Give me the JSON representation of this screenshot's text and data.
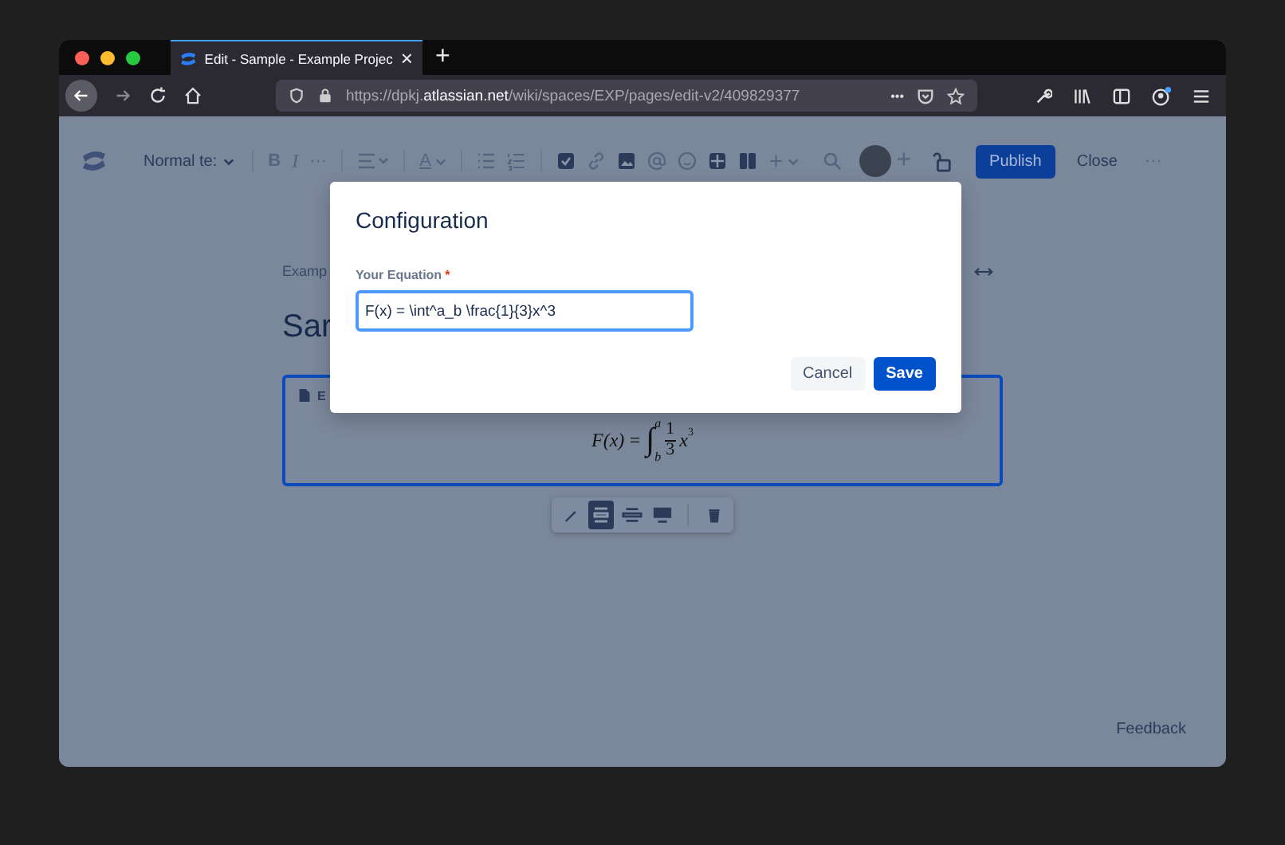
{
  "browser": {
    "tab": {
      "title": "Edit - Sample - Example Projec",
      "close": "×"
    },
    "new_tab": "+",
    "url": {
      "prefix": "https://dpkj.",
      "domain": "atlassian.net",
      "path": "/wiki/spaces/EXP/pages/edit-v2/409829377"
    },
    "page_actions": "•••"
  },
  "editor_toolbar": {
    "text_style": "Normal te:",
    "bold": "B",
    "italic": "I",
    "more": "···",
    "text_color": "A",
    "insert": "+",
    "collaborator_add": "+",
    "publish": "Publish",
    "close": "Close",
    "more_menu": "···"
  },
  "breadcrumb": "Examp",
  "page_title": "Sar",
  "macro": {
    "header": "E",
    "selected": true,
    "formula": {
      "lhs": "F(x) =",
      "integral": "∫",
      "upper": "a",
      "lower": "b",
      "numerator": "1",
      "denominator": "3",
      "base": "x",
      "exponent": "3"
    }
  },
  "macro_toolbar": [
    {
      "kind": "edit",
      "selected": false
    },
    {
      "kind": "layout-center",
      "selected": true
    },
    {
      "kind": "layout-wide",
      "selected": false
    },
    {
      "kind": "layout-full",
      "selected": false
    },
    {
      "kind": "delete",
      "selected": false
    }
  ],
  "dialog": {
    "title": "Configuration",
    "field": {
      "label": "Your Equation",
      "required": "*",
      "value": "F(x) = \\int^a_b \\frac{1}{3}x^3"
    },
    "buttons": [
      {
        "label": "Cancel",
        "kind": "secondary"
      },
      {
        "label": "Save",
        "kind": "primary"
      }
    ]
  },
  "feedback": "Feedback"
}
